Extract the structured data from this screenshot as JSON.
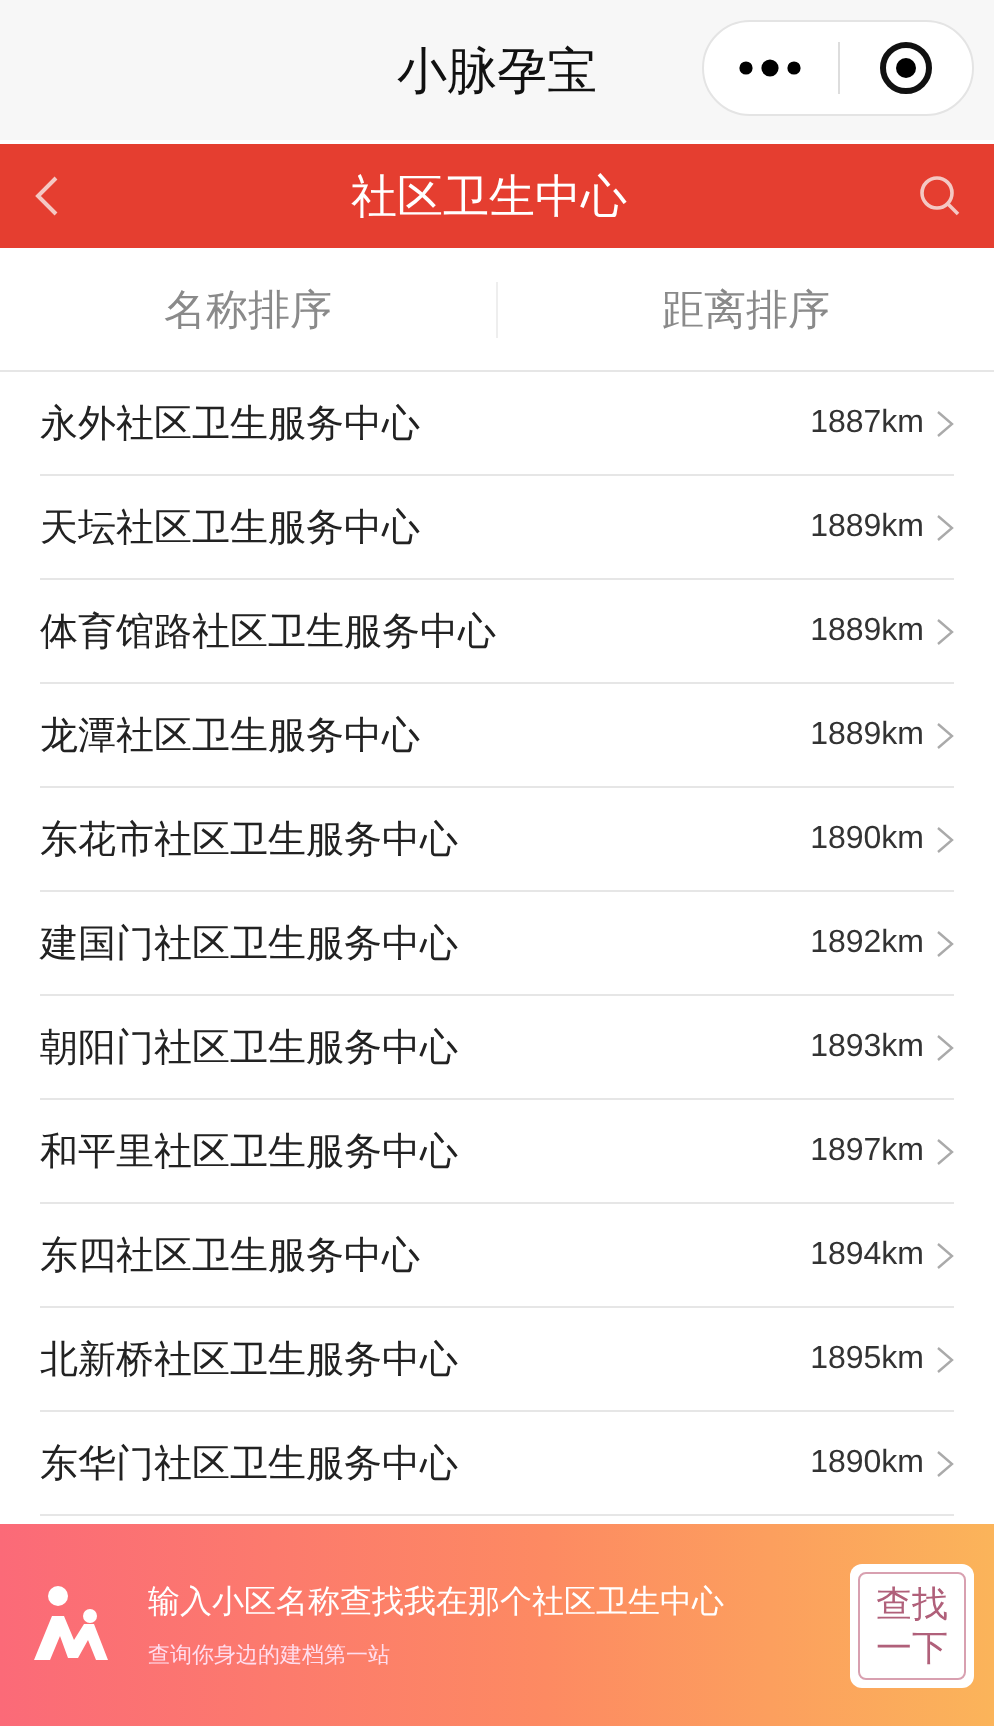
{
  "window": {
    "title": "小脉孕宝"
  },
  "header": {
    "title": "社区卫生中心"
  },
  "tabs": [
    {
      "label": "名称排序",
      "selected": false
    },
    {
      "label": "距离排序",
      "selected": false
    }
  ],
  "centers": [
    {
      "name": "永外社区卫生服务中心",
      "distance": "1887km"
    },
    {
      "name": "天坛社区卫生服务中心",
      "distance": "1889km"
    },
    {
      "name": "体育馆路社区卫生服务中心",
      "distance": "1889km"
    },
    {
      "name": "龙潭社区卫生服务中心",
      "distance": "1889km"
    },
    {
      "name": "东花市社区卫生服务中心",
      "distance": "1890km"
    },
    {
      "name": "建国门社区卫生服务中心",
      "distance": "1892km"
    },
    {
      "name": "朝阳门社区卫生服务中心",
      "distance": "1893km"
    },
    {
      "name": "和平里社区卫生服务中心",
      "distance": "1897km"
    },
    {
      "name": "东四社区卫生服务中心",
      "distance": "1894km"
    },
    {
      "name": "北新桥社区卫生服务中心",
      "distance": "1895km"
    },
    {
      "name": "东华门社区卫生服务中心",
      "distance": "1890km"
    }
  ],
  "banner": {
    "headline": "输入小区名称查找我在那个社区卫生中心",
    "subtitle": "查询你身边的建档第一站",
    "button": "查找一下"
  }
}
